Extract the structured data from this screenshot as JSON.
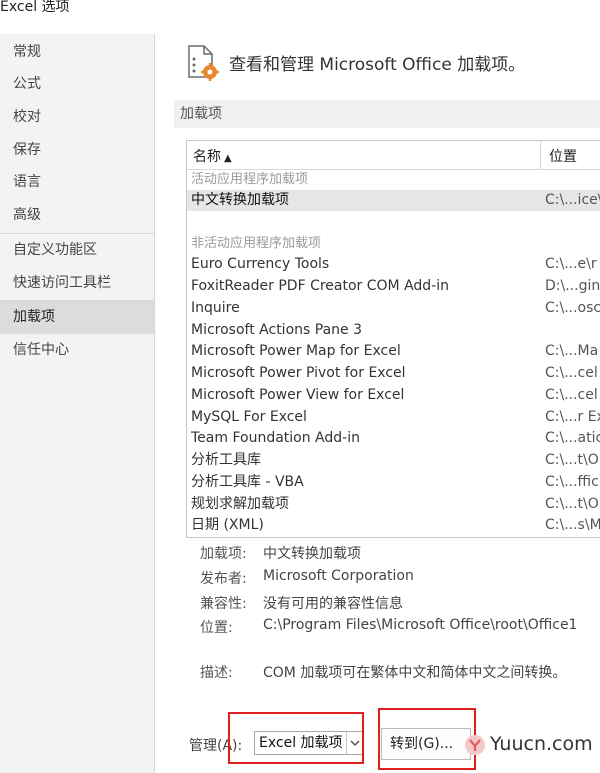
{
  "window": {
    "title": "Excel 选项"
  },
  "sidebar": {
    "items": [
      {
        "label": "常规"
      },
      {
        "label": "公式"
      },
      {
        "label": "校对"
      },
      {
        "label": "保存"
      },
      {
        "label": "语言"
      },
      {
        "label": "高级"
      },
      {
        "label": "自定义功能区"
      },
      {
        "label": "快速访问工具栏"
      },
      {
        "label": "加载项",
        "active": true
      },
      {
        "label": "信任中心"
      }
    ]
  },
  "header": {
    "text": "查看和管理 Microsoft Office 加载项。"
  },
  "section": {
    "title": "加载项"
  },
  "addins_table": {
    "columns": {
      "name": "名称",
      "name_sort_glyph": "▲",
      "location": "位置"
    },
    "active_group_label": "活动应用程序加载项",
    "active": [
      {
        "name": "中文转换加载项",
        "location": "C:\\...ice\\"
      }
    ],
    "inactive_group_label": "非活动应用程序加载项",
    "inactive": [
      {
        "name": "Euro Currency Tools",
        "location": "C:\\...e\\r"
      },
      {
        "name": "FoxitReader PDF Creator COM Add-in",
        "location": "D:\\...gin"
      },
      {
        "name": "Inquire",
        "location": "C:\\...osc"
      },
      {
        "name": "Microsoft Actions Pane 3",
        "location": ""
      },
      {
        "name": "Microsoft Power Map for Excel",
        "location": "C:\\...Ma"
      },
      {
        "name": "Microsoft Power Pivot for Excel",
        "location": "C:\\...cel"
      },
      {
        "name": "Microsoft Power View for Excel",
        "location": "C:\\...cel"
      },
      {
        "name": "MySQL For Excel",
        "location": "C:\\...r Ex"
      },
      {
        "name": "Team Foundation Add-in",
        "location": "C:\\...atic"
      },
      {
        "name": "分析工具库",
        "location": "C:\\...t\\O"
      },
      {
        "name": "分析工具库 - VBA",
        "location": "C:\\...ffic"
      },
      {
        "name": "规划求解加载项",
        "location": "C:\\...t\\O"
      },
      {
        "name": "日期 (XML)",
        "location": "C:\\...s\\M"
      }
    ]
  },
  "details": {
    "addin_label": "加载项:",
    "addin_value": "中文转换加载项",
    "publisher_label": "发布者:",
    "publisher_value": "Microsoft Corporation",
    "compat_label": "兼容性:",
    "compat_value": "没有可用的兼容性信息",
    "location_label": "位置:",
    "location_value": "C:\\Program Files\\Microsoft Office\\root\\Office1",
    "desc_label": "描述:",
    "desc_value": "COM 加载项可在繁体中文和简体中文之间转换。"
  },
  "manage": {
    "label": "管理(A):",
    "selected": "Excel 加载项",
    "go_button": "转到(G)...",
    "highlight_color": "#e02020"
  },
  "watermark": {
    "text": "Yuucn.com"
  }
}
